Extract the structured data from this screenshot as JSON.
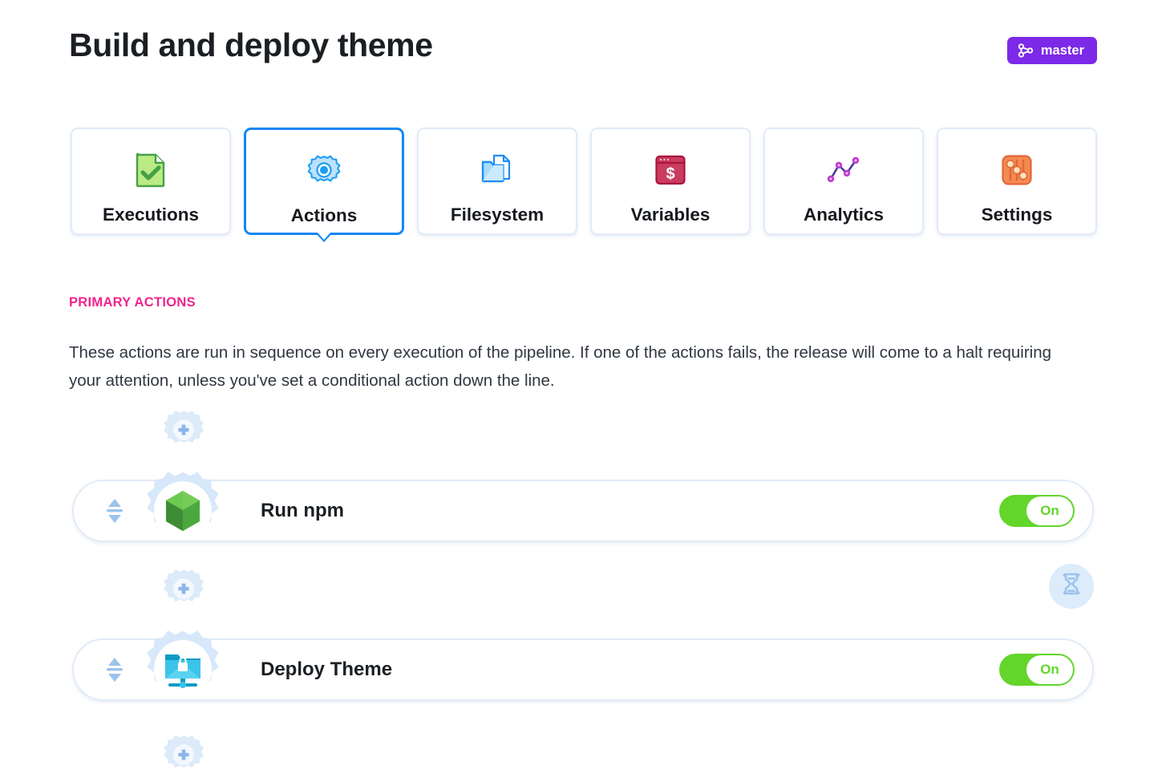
{
  "header": {
    "title": "Build and deploy theme",
    "branch": {
      "label": "master",
      "icon": "git-branch-icon",
      "color": "#7c29e8"
    }
  },
  "tabs": [
    {
      "id": "executions",
      "label": "Executions",
      "icon": "document-check-icon",
      "active": false
    },
    {
      "id": "actions",
      "label": "Actions",
      "icon": "gear-icon",
      "active": true
    },
    {
      "id": "filesystem",
      "label": "Filesystem",
      "icon": "folder-file-icon",
      "active": false
    },
    {
      "id": "variables",
      "label": "Variables",
      "icon": "dollar-window-icon",
      "active": false
    },
    {
      "id": "analytics",
      "label": "Analytics",
      "icon": "line-chart-icon",
      "active": false
    },
    {
      "id": "settings",
      "label": "Settings",
      "icon": "sliders-icon",
      "active": false
    }
  ],
  "primary_actions": {
    "section_label": "PRIMARY ACTIONS",
    "section_label_color": "#f0258c",
    "description": "These actions are run in sequence on every execution of the pipeline. If one of the actions fails, the release will come to a halt requiring your attention, unless you've set a conditional action down the line.",
    "add_button_icon": "plus-gear-icon",
    "rows": [
      {
        "label": "Run npm",
        "icon": "nodejs-hexagon-icon",
        "drag_handle_icon": "drag-updown-icon",
        "toggle": {
          "label": "On",
          "state": "on",
          "color": "#63d52b"
        }
      },
      {
        "label": "Deploy Theme",
        "icon": "sftp-folder-lock-icon",
        "drag_handle_icon": "drag-updown-icon",
        "toggle": {
          "label": "On",
          "state": "on",
          "color": "#63d52b"
        }
      }
    ],
    "wait_badge": {
      "icon": "hourglass-icon"
    }
  }
}
